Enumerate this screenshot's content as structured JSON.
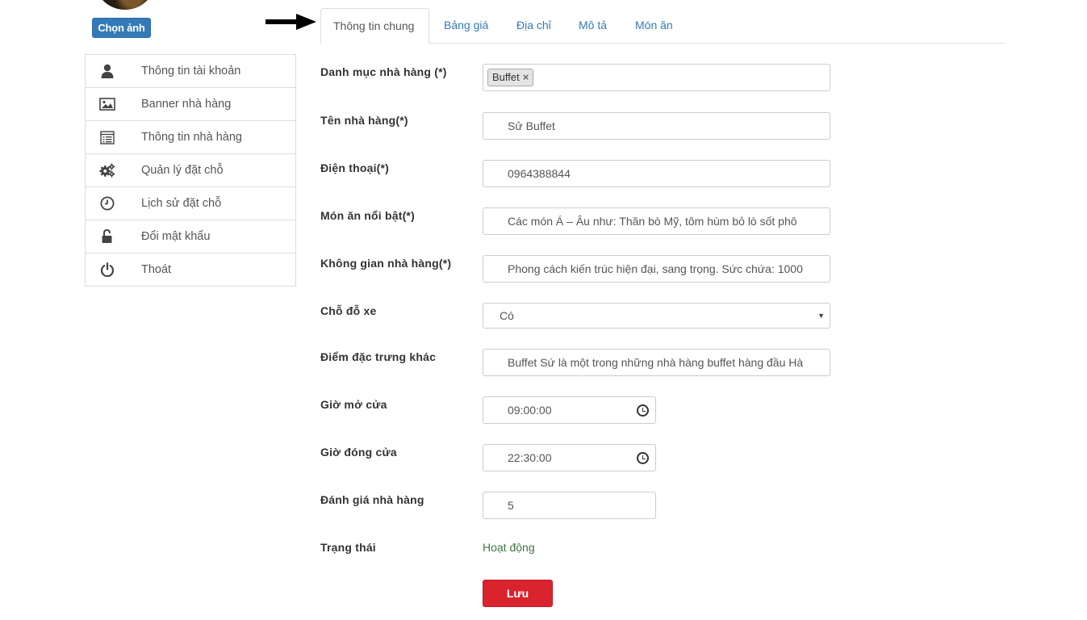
{
  "profile": {
    "choose_photo_label": "Chọn ảnh"
  },
  "sidebar": {
    "items": [
      {
        "icon": "user-icon",
        "label": "Thông tin tài khoản"
      },
      {
        "icon": "image-icon",
        "label": "Banner nhà hàng"
      },
      {
        "icon": "list-alt-icon",
        "label": "Thông tin nhà hàng"
      },
      {
        "icon": "cogs-icon",
        "label": "Quản lý đặt chỗ"
      },
      {
        "icon": "clock-icon",
        "label": "Lịch sử đặt chỗ"
      },
      {
        "icon": "unlock-icon",
        "label": "Đổi mật khẩu"
      },
      {
        "icon": "power-icon",
        "label": "Thoát"
      }
    ]
  },
  "tabs": [
    {
      "label": "Thông tin chung",
      "active": true
    },
    {
      "label": "Bảng giá",
      "active": false
    },
    {
      "label": "Địa chỉ",
      "active": false
    },
    {
      "label": "Mô tả",
      "active": false
    },
    {
      "label": "Món ăn",
      "active": false
    }
  ],
  "form": {
    "category": {
      "label": "Danh mục nhà hàng (*)",
      "tags": [
        "Buffet"
      ],
      "remove_glyph": "×"
    },
    "name": {
      "label": "Tên nhà hàng(*)",
      "value": "Sử Buffet"
    },
    "phone": {
      "label": "Điện thoại(*)",
      "value": "0964388844"
    },
    "featured_dishes": {
      "label": "Món ăn nổi bật(*)",
      "value": "Các món Á – Âu như: Thăn bò Mỹ, tôm hùm bỏ lò sốt phô"
    },
    "space": {
      "label": "Không gian nhà hàng(*)",
      "value": "Phong cách kiến trúc hiện đại, sang trọng. Sức chứa: 1000"
    },
    "parking": {
      "label": "Chỗ đỗ xe",
      "selected": "Có",
      "caret": "▼"
    },
    "highlights": {
      "label": "Điểm đặc trưng khác",
      "value": "Buffet Sứ là một trong những nhà hàng buffet hàng đầu Hà"
    },
    "open_time": {
      "label": "Giờ mở cửa",
      "value": "09:00:00"
    },
    "close_time": {
      "label": "Giờ đóng cửa",
      "value": "22:30:00"
    },
    "rating": {
      "label": "Đánh giá nhà hàng",
      "value": "5"
    },
    "status": {
      "label": "Trạng thái",
      "value": "Hoạt động"
    }
  },
  "actions": {
    "save_label": "Lưu"
  },
  "colors": {
    "primary": "#337ab7",
    "danger": "#d9232d",
    "success": "#3c763d"
  }
}
